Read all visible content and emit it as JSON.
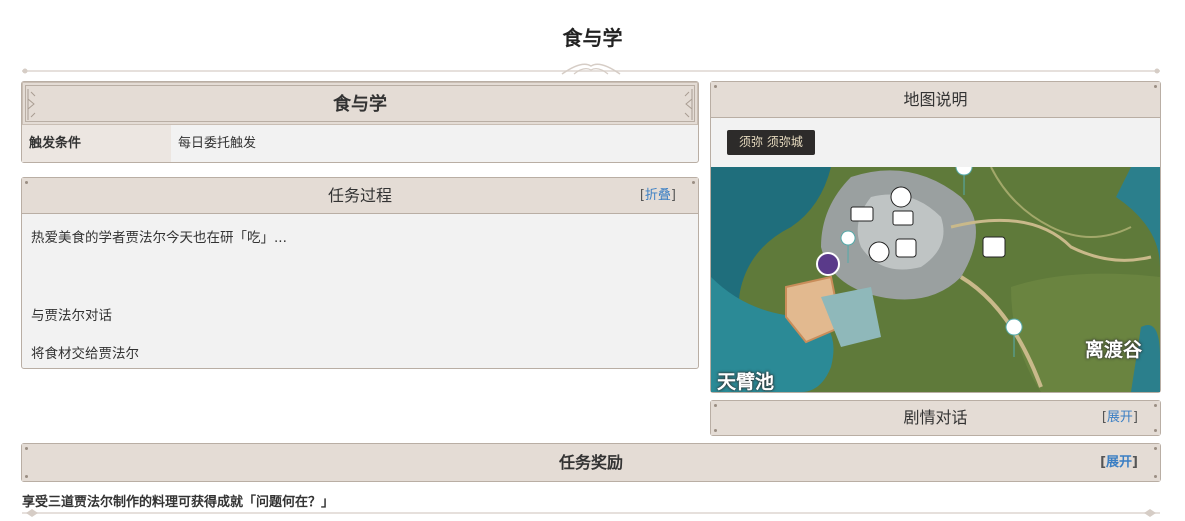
{
  "page": {
    "title": "食与学"
  },
  "info_card": {
    "title": "食与学",
    "trigger_label": "触发条件",
    "trigger_value": "每日委托触发"
  },
  "process": {
    "title": "任务过程",
    "toggle_open": "[",
    "toggle_label": "折叠",
    "toggle_close": "]",
    "intro": "热爱美食的学者贾法尔今天也在研「吃」...",
    "steps": [
      "与贾法尔对话",
      "将食材交给贾法尔"
    ]
  },
  "map": {
    "title": "地图说明",
    "region_tag": "须弥  须弥城",
    "labels": {
      "valley": "离渡谷",
      "pool": "天臂池"
    },
    "icons": [
      "teleport-waypoint-icon",
      "blacksmith-icon",
      "gem-shop-icon",
      "compass-icon",
      "alchemy-icon",
      "chest-icon",
      "statue-icon"
    ]
  },
  "dialogue": {
    "title": "剧情对话",
    "toggle_open": "[",
    "toggle_label": "展开",
    "toggle_close": "]"
  },
  "reward": {
    "title": "任务奖励",
    "toggle_open": "[",
    "toggle_label": "展开",
    "toggle_close": "]",
    "text": "享受三道贾法尔制作的料理可获得成就「问题何在？」"
  },
  "colors": {
    "header_bg": "#e4dcd5",
    "border": "#b9aea4",
    "panel_bg": "#f2f2f2",
    "link": "#3b7fc4",
    "region_tag_bg": "#2d2b2a"
  }
}
